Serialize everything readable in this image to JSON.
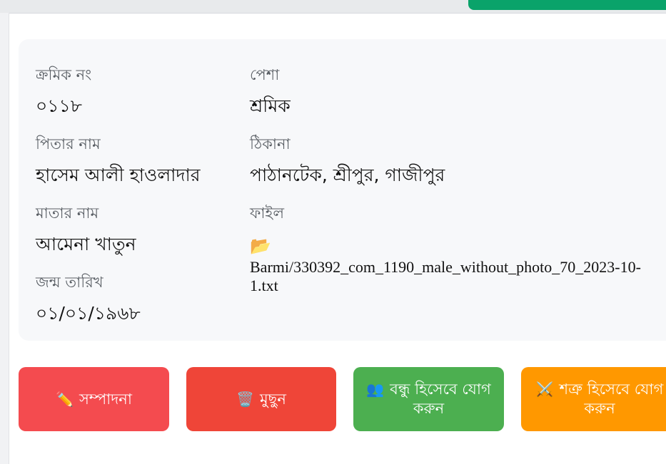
{
  "record": {
    "serial_label": "ক্রমিক নং",
    "serial_value": "০১১৮",
    "occupation_label": "পেশা",
    "occupation_value": "শ্রমিক",
    "father_label": "পিতার নাম",
    "father_value": "হাসেম আলী হাওলাদার",
    "address_label": "ঠিকানা",
    "address_value": "পাঠানটেক, শ্রীপুর, গাজীপুর",
    "mother_label": "মাতার নাম",
    "mother_value": "আমেনা খাতুন",
    "file_label": "ফাইল",
    "file_icon": "📂",
    "file_value": "Barmi/330392_com_1190_male_without_photo_70_2023-10-1.txt",
    "dob_label": "জন্ম তারিখ",
    "dob_value": "০১/০১/১৯৬৮"
  },
  "actions": {
    "edit": {
      "icon": "✏️",
      "label": "সম্পাদনা",
      "color": "#f44b4f"
    },
    "delete": {
      "icon": "🗑️",
      "label": "মুছুন",
      "color": "#ef4538"
    },
    "friend": {
      "icon": "👥",
      "label": "বন্ধু হিসেবে যোগ করুন",
      "color": "#4caf50"
    },
    "enemy": {
      "icon": "⚔️",
      "label": "শত্রু হিসেবে যোগ করুন",
      "color": "#ff9800"
    }
  }
}
